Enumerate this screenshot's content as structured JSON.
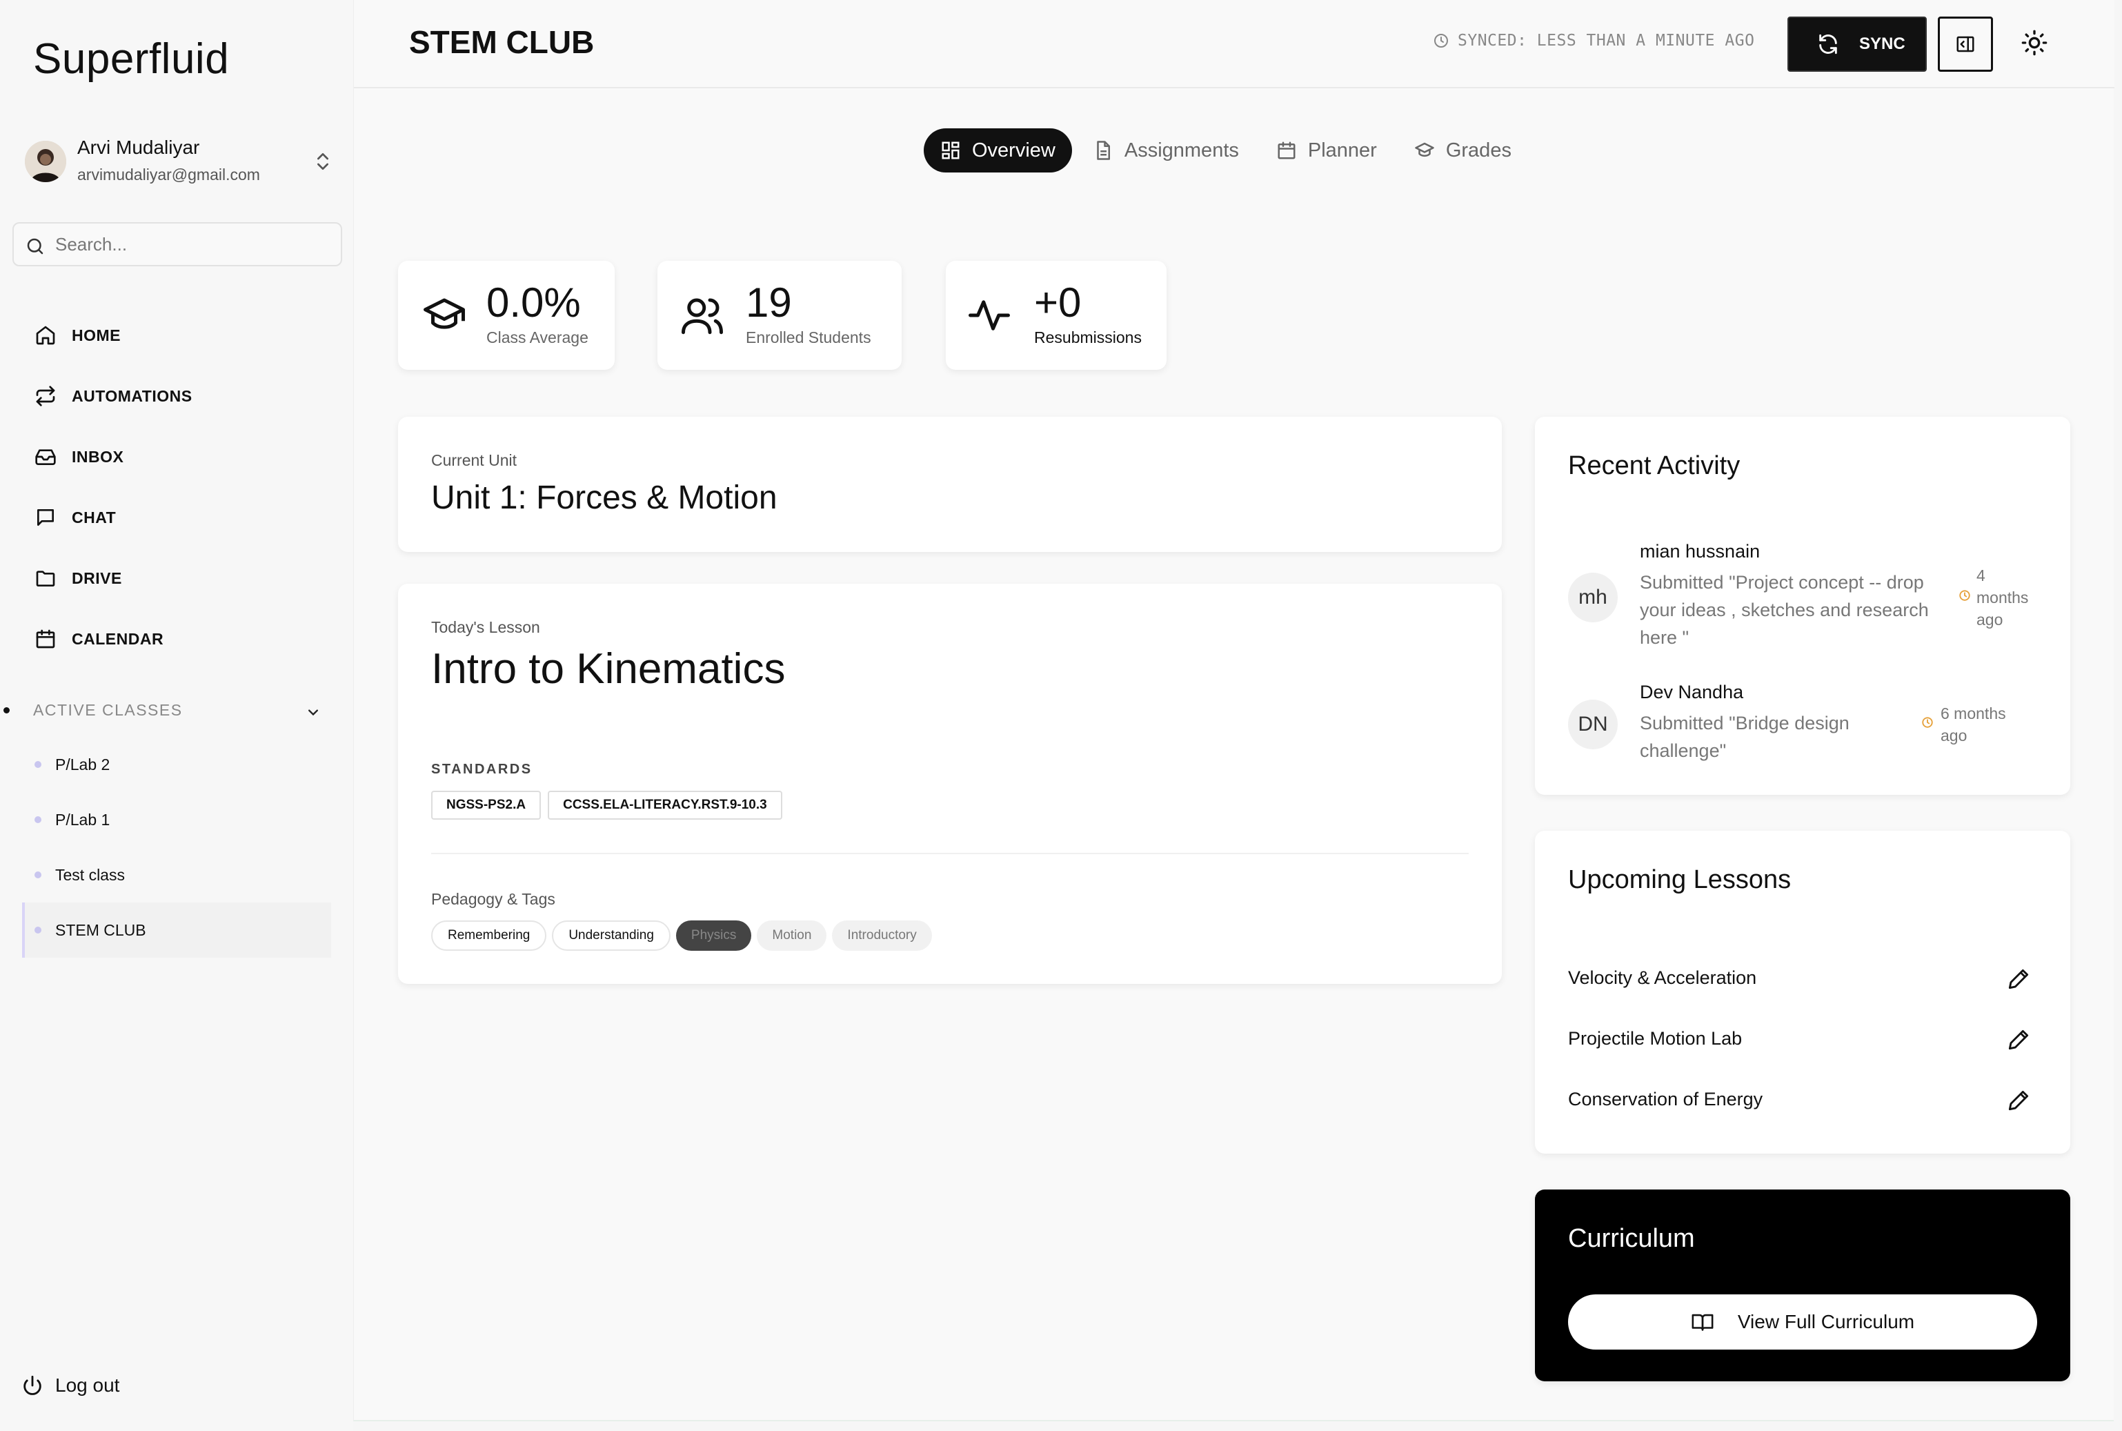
{
  "app": {
    "brand": "Superfluid"
  },
  "user": {
    "name": "Arvi Mudaliyar",
    "email": "arvimudaliyar@gmail.com",
    "avatar_icon": "user-photo",
    "switch_icon": "chevrons-up-down-icon"
  },
  "search": {
    "placeholder": "Search...",
    "value": ""
  },
  "nav": {
    "items": [
      {
        "label": "HOME",
        "icon": "home-icon"
      },
      {
        "label": "AUTOMATIONS",
        "icon": "repeat-icon"
      },
      {
        "label": "INBOX",
        "icon": "inbox-icon"
      },
      {
        "label": "CHAT",
        "icon": "chat-icon"
      },
      {
        "label": "DRIVE",
        "icon": "folder-icon"
      },
      {
        "label": "CALENDAR",
        "icon": "calendar-icon"
      }
    ]
  },
  "classes": {
    "heading": "ACTIVE CLASSES",
    "items": [
      {
        "label": "P/Lab 2"
      },
      {
        "label": "P/Lab 1"
      },
      {
        "label": "Test class"
      },
      {
        "label": "STEM CLUB",
        "active": true
      }
    ]
  },
  "logout": {
    "label": "Log out"
  },
  "header": {
    "title": "STEM CLUB",
    "synced": "SYNCED: LESS THAN A MINUTE AGO",
    "sync_label": "SYNC"
  },
  "tabs": [
    {
      "label": "Overview",
      "icon": "grid-icon",
      "active": true
    },
    {
      "label": "Assignments",
      "icon": "document-icon"
    },
    {
      "label": "Planner",
      "icon": "calendar-icon"
    },
    {
      "label": "Grades",
      "icon": "graduation-cap-icon"
    }
  ],
  "stats": [
    {
      "value": "0.0%",
      "caption": "Class Average",
      "icon": "graduation-cap-icon"
    },
    {
      "value": "19",
      "caption": "Enrolled Students",
      "icon": "users-icon"
    },
    {
      "value": "+0",
      "caption": "Resubmissions",
      "icon": "activity-icon"
    }
  ],
  "current_unit": {
    "label": "Current Unit",
    "value": "Unit 1: Forces & Motion"
  },
  "todays_lesson": {
    "label": "Today's Lesson",
    "title": "Intro to Kinematics",
    "standards_label": "STANDARDS",
    "standards": [
      "NGSS-PS2.A",
      "CCSS.ELA-LITERACY.RST.9-10.3"
    ],
    "pedagogy_label": "Pedagogy & Tags",
    "tags": [
      {
        "label": "Remembering",
        "style": "outline"
      },
      {
        "label": "Understanding",
        "style": "outline"
      },
      {
        "label": "Physics",
        "style": "dark"
      },
      {
        "label": "Motion",
        "style": "muted"
      },
      {
        "label": "Introductory",
        "style": "muted"
      }
    ]
  },
  "recent_activity": {
    "title": "Recent Activity",
    "items": [
      {
        "initials": "mh",
        "name": "mian hussnain",
        "lines": [
          "Submitted \"Project concept -- drop",
          "your ideas , sketches and research",
          "here \""
        ],
        "time": [
          "4",
          "months",
          "ago"
        ]
      },
      {
        "initials": "DN",
        "name": "Dev Nandha",
        "lines": [
          "Submitted \"Bridge design",
          "challenge\""
        ],
        "time": [
          "6 months",
          "ago"
        ]
      }
    ],
    "clock_color": "#e6a23c"
  },
  "upcoming": {
    "title": "Upcoming Lessons",
    "items": [
      {
        "label": "Velocity & Acceleration",
        "icon": "pencil-icon"
      },
      {
        "label": "Projectile Motion Lab",
        "icon": "pencil-icon"
      },
      {
        "label": "Conservation of Energy",
        "icon": "pencil-icon"
      }
    ]
  },
  "curriculum": {
    "title": "Curriculum",
    "button": "View Full Curriculum",
    "icon": "book-open-icon"
  }
}
